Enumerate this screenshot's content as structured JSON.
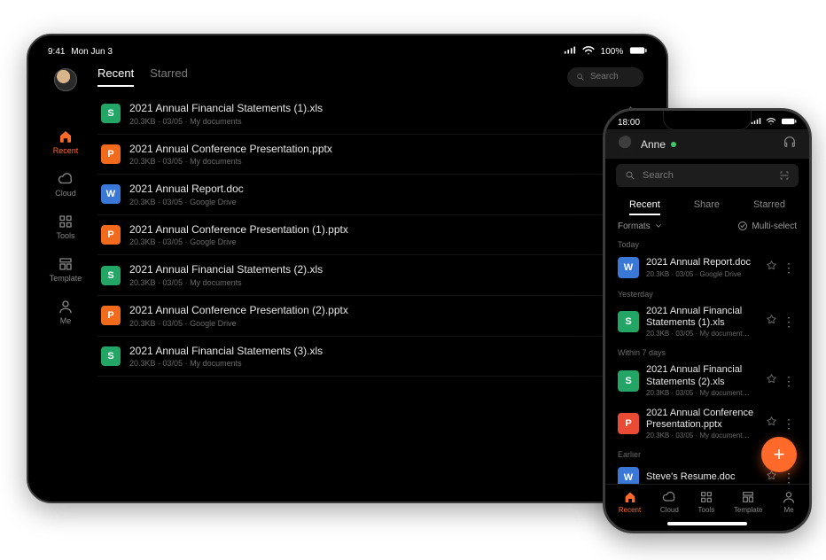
{
  "tablet": {
    "status": {
      "time": "9:41",
      "date": "Mon Jun 3",
      "wifi_label": "100%"
    },
    "tabs": {
      "recent": "Recent",
      "starred": "Starred"
    },
    "search_placeholder": "Search",
    "sidebar": {
      "recent": "Recent",
      "cloud": "Cloud",
      "tools": "Tools",
      "template": "Template",
      "me": "Me"
    },
    "files": [
      {
        "icon": "S",
        "color": "green",
        "name": "2021 Annual Financial Statements (1).xls",
        "size": "20.3KB",
        "date": "03/05",
        "loc": "My documents"
      },
      {
        "icon": "P",
        "color": "orange",
        "name": "2021 Annual Conference Presentation.pptx",
        "size": "20.3KB",
        "date": "03/05",
        "loc": "My documents"
      },
      {
        "icon": "W",
        "color": "blue",
        "name": "2021 Annual Report.doc",
        "size": "20.3KB",
        "date": "03/05",
        "loc": "Google Drive"
      },
      {
        "icon": "P",
        "color": "orange",
        "name": "2021 Annual Conference Presentation (1).pptx",
        "size": "20.3KB",
        "date": "03/05",
        "loc": "Google Drive"
      },
      {
        "icon": "S",
        "color": "green",
        "name": "2021 Annual Financial Statements (2).xls",
        "size": "20.3KB",
        "date": "03/05",
        "loc": "My documents"
      },
      {
        "icon": "P",
        "color": "orange",
        "name": "2021 Annual Conference Presentation (2).pptx",
        "size": "20.3KB",
        "date": "03/05",
        "loc": "Google Drive"
      },
      {
        "icon": "S",
        "color": "green",
        "name": "2021 Annual Financial Statements (3).xls",
        "size": "20.3KB",
        "date": "03/05",
        "loc": "My documents"
      }
    ]
  },
  "phone": {
    "status_time": "18:00",
    "user_name": "Anne",
    "search_placeholder": "Search",
    "tabs": {
      "recent": "Recent",
      "share": "Share",
      "starred": "Starred"
    },
    "subbar": {
      "formats": "Formats",
      "multi": "Multi-select"
    },
    "sections": {
      "today": "Today",
      "yesterday": "Yesterday",
      "week": "Within 7 days",
      "earlier": "Earlier"
    },
    "files": {
      "today": [
        {
          "icon": "W",
          "color": "blue",
          "name": "2021 Annual Report.doc",
          "size": "20.3KB",
          "date": "03/05",
          "loc": "Google Drive"
        }
      ],
      "yesterday": [
        {
          "icon": "S",
          "color": "green",
          "name": "2021 Annual Financial Statements (1).xls",
          "size": "20.3KB",
          "date": "03/05",
          "loc": "My documentsabcdefgh..."
        }
      ],
      "week": [
        {
          "icon": "S",
          "color": "green",
          "name": "2021 Annual Financial Statements (2).xls",
          "size": "20.3KB",
          "date": "03/05",
          "loc": "My documentsabcdefgh..."
        },
        {
          "icon": "P",
          "color": "red",
          "name": "2021 Annual Conference Presentation.pptx",
          "size": "20.3KB",
          "date": "03/05",
          "loc": "My documentsabcdefgh..."
        }
      ],
      "earlier": [
        {
          "icon": "W",
          "color": "blue",
          "name": "Steve's Resume.doc",
          "size": "",
          "date": "",
          "loc": ""
        }
      ]
    },
    "nav": {
      "recent": "Recent",
      "cloud": "Cloud",
      "tools": "Tools",
      "template": "Template",
      "me": "Me"
    }
  }
}
